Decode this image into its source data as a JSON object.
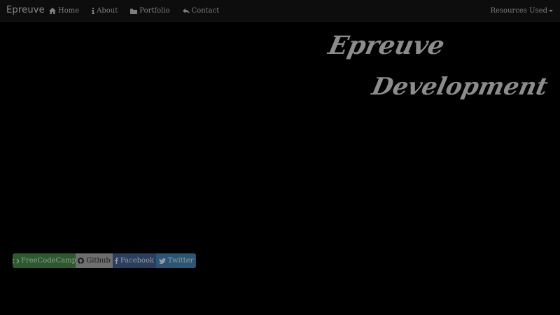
{
  "navbar": {
    "brand": "Epreuve",
    "links": [
      {
        "label": "Home",
        "icon": "home-icon"
      },
      {
        "label": "About",
        "icon": "info-icon"
      },
      {
        "label": "Portfolio",
        "icon": "folder-icon"
      },
      {
        "label": "Contact",
        "icon": "reply-icon"
      }
    ],
    "dropdown_label": "Resources Used"
  },
  "hero": {
    "line1": "Epreuve",
    "line2": "Development"
  },
  "social": [
    {
      "label": "FreeCodeCamp",
      "icon": "code-icon",
      "color": "#2c5a2c"
    },
    {
      "label": "Github",
      "icon": "github-icon",
      "color": "#6e6e6e"
    },
    {
      "label": "Facebook",
      "icon": "facebook-icon",
      "color": "#2a3e60"
    },
    {
      "label": "Twitter",
      "icon": "twitter-icon",
      "color": "#2a5575"
    }
  ],
  "colors": {
    "background": "#000000",
    "navbar": "#0d0d0d",
    "text": "#7d7d7d"
  }
}
